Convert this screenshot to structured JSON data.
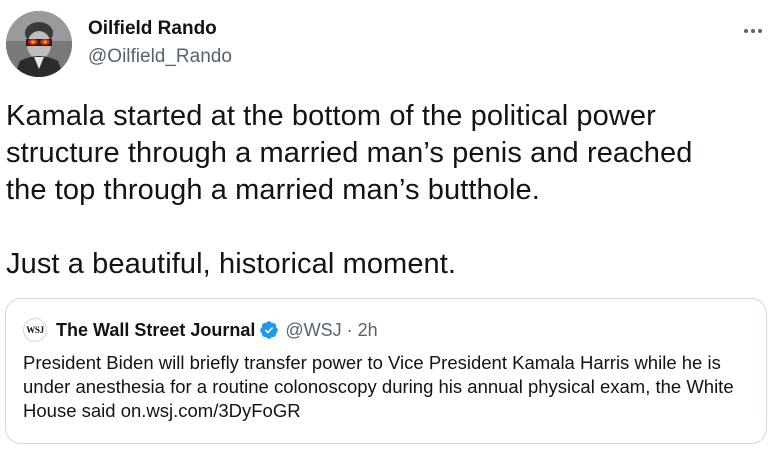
{
  "tweet": {
    "author": {
      "display_name": "Oilfield Rando",
      "handle": "@Oilfield_Rando",
      "avatar_icon": "profile-photo"
    },
    "more_icon": "more-options-icon",
    "text": "Kamala started at the bottom of the political power\nstructure through a married man’s penis and reached\nthe top through a married man’s butthole.\n\nJust a beautiful, historical moment."
  },
  "quote": {
    "logo_text": "WSJ",
    "name": "The Wall Street Journal",
    "verified_icon": "verified-badge-icon",
    "handle": "@WSJ",
    "separator": "·",
    "time": "2h",
    "text": "President Biden will briefly transfer power to Vice President Kamala Harris while he is under anesthesia for a routine colonoscopy during his annual physical exam, the White House said on.wsj.com/3DyFoGR"
  },
  "colors": {
    "text_primary": "#0f1419",
    "text_secondary": "#536471",
    "border": "#cfd9de",
    "verified_blue": "#1d9bf0"
  }
}
